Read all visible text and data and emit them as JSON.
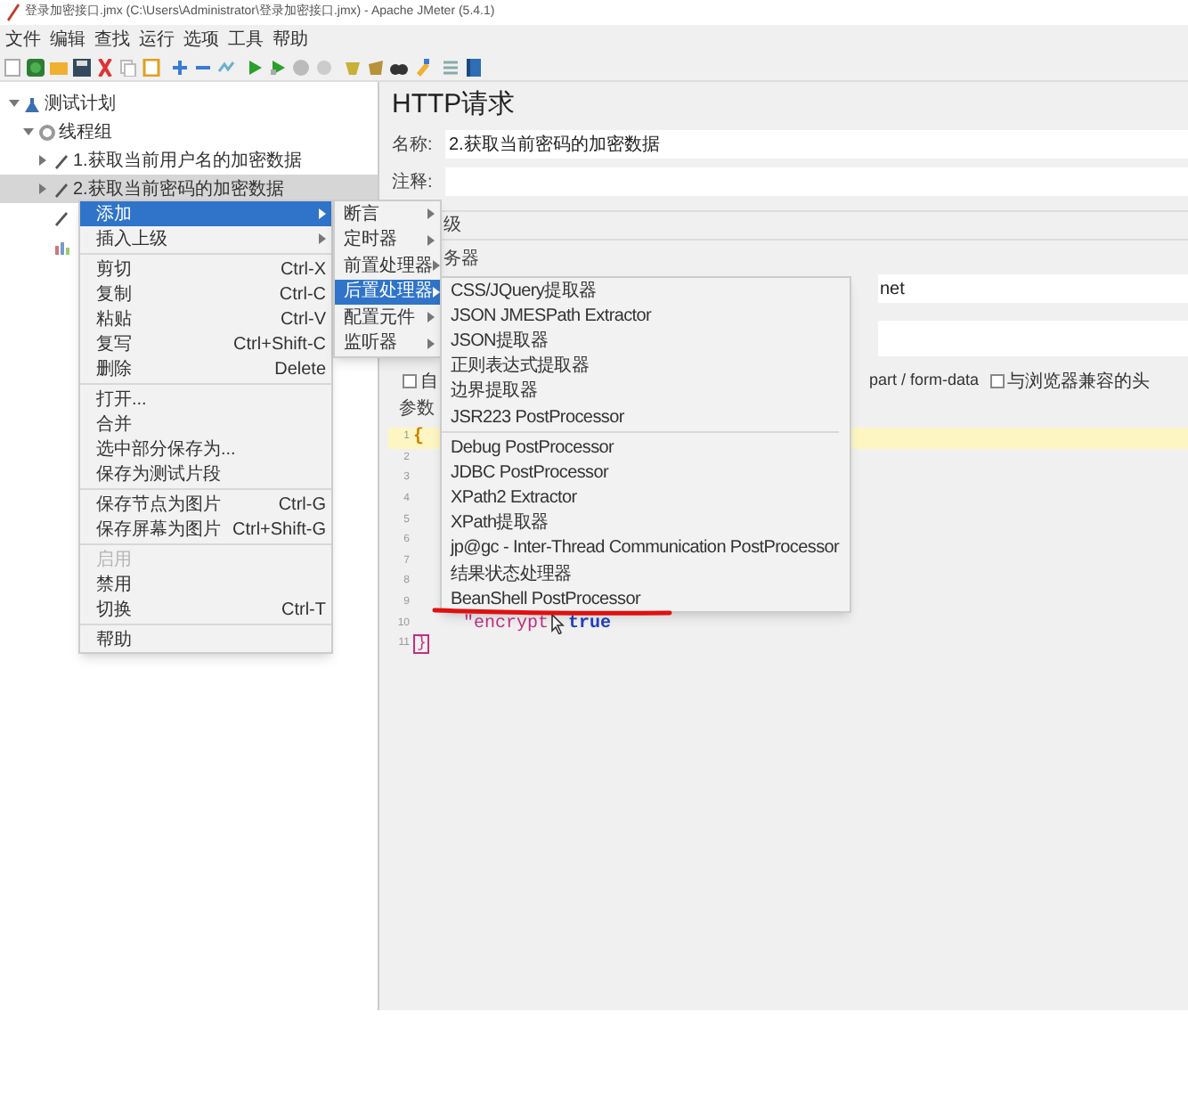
{
  "window": {
    "title": "登录加密接口.jmx (C:\\Users\\Administrator\\登录加密接口.jmx) - Apache JMeter (5.4.1)"
  },
  "menu_bar": [
    "文件",
    "编辑",
    "查找",
    "运行",
    "选项",
    "工具",
    "帮助"
  ],
  "tree": [
    {
      "label": "测试计划",
      "kind": "plan",
      "expanded": true,
      "selected": false,
      "children": [
        {
          "label": "线程组",
          "kind": "thread_group",
          "expanded": true,
          "selected": false,
          "children": [
            {
              "label": "1.获取当前用户名的加密数据",
              "kind": "sampler",
              "expanded": false,
              "selected": false
            },
            {
              "label": "2.获取当前密码的加密数据",
              "kind": "sampler",
              "expanded": false,
              "selected": true
            },
            {
              "kind": "sampler",
              "selected": false
            },
            {
              "kind": "listener",
              "selected": false
            }
          ]
        }
      ]
    }
  ],
  "context_menu": [
    {
      "kind": "item",
      "label": "添加",
      "submenu": true,
      "selected": true,
      "disabled": false
    },
    {
      "kind": "item",
      "label": "插入上级",
      "submenu": true,
      "selected": false,
      "disabled": false
    },
    {
      "kind": "separator"
    },
    {
      "kind": "item",
      "label": "剪切",
      "shortcut": "Ctrl-X",
      "submenu": false,
      "selected": false,
      "disabled": false
    },
    {
      "kind": "item",
      "label": "复制",
      "shortcut": "Ctrl-C",
      "submenu": false,
      "selected": false,
      "disabled": false
    },
    {
      "kind": "item",
      "label": "粘贴",
      "shortcut": "Ctrl-V",
      "submenu": false,
      "selected": false,
      "disabled": false
    },
    {
      "kind": "item",
      "label": "复写",
      "shortcut": "Ctrl+Shift-C",
      "submenu": false,
      "selected": false,
      "disabled": false
    },
    {
      "kind": "item",
      "label": "删除",
      "shortcut": "Delete",
      "submenu": false,
      "selected": false,
      "disabled": false
    },
    {
      "kind": "separator"
    },
    {
      "kind": "item",
      "label": "打开...",
      "submenu": false,
      "selected": false,
      "disabled": false
    },
    {
      "kind": "item",
      "label": "合并",
      "submenu": false,
      "selected": false,
      "disabled": false
    },
    {
      "kind": "item",
      "label": "选中部分保存为...",
      "submenu": false,
      "selected": false,
      "disabled": false
    },
    {
      "kind": "item",
      "label": "保存为测试片段",
      "submenu": false,
      "selected": false,
      "disabled": false
    },
    {
      "kind": "separator"
    },
    {
      "kind": "item",
      "label": "保存节点为图片",
      "shortcut": "Ctrl-G",
      "submenu": false,
      "selected": false,
      "disabled": false
    },
    {
      "kind": "item",
      "label": "保存屏幕为图片",
      "shortcut": "Ctrl+Shift-G",
      "submenu": false,
      "selected": false,
      "disabled": false
    },
    {
      "kind": "separator"
    },
    {
      "kind": "item",
      "label": "启用",
      "submenu": false,
      "selected": false,
      "disabled": true
    },
    {
      "kind": "item",
      "label": "禁用",
      "submenu": false,
      "selected": false,
      "disabled": false
    },
    {
      "kind": "item",
      "label": "切换",
      "shortcut": "Ctrl-T",
      "submenu": false,
      "selected": false,
      "disabled": false
    },
    {
      "kind": "separator"
    },
    {
      "kind": "item",
      "label": "帮助",
      "submenu": false,
      "selected": false,
      "disabled": false
    }
  ],
  "add_submenu": [
    {
      "label": "断言",
      "selected": false
    },
    {
      "label": "定时器",
      "selected": false
    },
    {
      "label": "前置处理器",
      "selected": false
    },
    {
      "label": "后置处理器",
      "selected": true
    },
    {
      "label": "配置元件",
      "selected": false
    },
    {
      "label": "监听器",
      "selected": false
    }
  ],
  "post_processor_submenu": [
    {
      "kind": "item",
      "label": "CSS/JQuery提取器"
    },
    {
      "kind": "item",
      "label": "JSON JMESPath Extractor"
    },
    {
      "kind": "item",
      "label": "JSON提取器"
    },
    {
      "kind": "item",
      "label": "正则表达式提取器"
    },
    {
      "kind": "item",
      "label": "边界提取器"
    },
    {
      "kind": "item",
      "label": "JSR223 PostProcessor"
    },
    {
      "kind": "separator"
    },
    {
      "kind": "item",
      "label": "Debug PostProcessor"
    },
    {
      "kind": "item",
      "label": "JDBC PostProcessor"
    },
    {
      "kind": "item",
      "label": "XPath2 Extractor"
    },
    {
      "kind": "item",
      "label": "XPath提取器"
    },
    {
      "kind": "item",
      "label": "jp@gc - Inter-Thread Communication PostProcessor"
    },
    {
      "kind": "item",
      "label": "结果状态处理器"
    },
    {
      "kind": "item",
      "label": "BeanShell PostProcessor"
    }
  ],
  "panel": {
    "title": "HTTP请求",
    "name_label": "名称:",
    "name_value": "2.获取当前密码的加密数据",
    "comment_label": "注释:",
    "section_fragment": "级",
    "server_fragment": "务器",
    "server_value": "net",
    "checkbox_row": [
      {
        "label": "自",
        "checked": false
      },
      {
        "text": "part / form-data"
      },
      {
        "label": "与浏览器兼容的头",
        "checked": false
      }
    ],
    "params_label": "参数"
  },
  "editor": {
    "lines": [
      {
        "number": "1",
        "highlighted": true
      },
      {
        "number": "2",
        "highlighted": false
      },
      {
        "number": "3",
        "highlighted": false
      },
      {
        "number": "4",
        "highlighted": false
      },
      {
        "number": "5",
        "highlighted": false
      },
      {
        "number": "6",
        "highlighted": false
      },
      {
        "number": "7",
        "highlighted": false
      },
      {
        "number": "8",
        "highlighted": false
      },
      {
        "number": "9",
        "highlighted": false
      },
      {
        "number": "10",
        "highlighted": false
      },
      {
        "number": "11",
        "highlighted": false
      }
    ],
    "open_brace": "{",
    "key_text": "\"encrypt",
    "value_text": "true",
    "close_brace": "}"
  }
}
